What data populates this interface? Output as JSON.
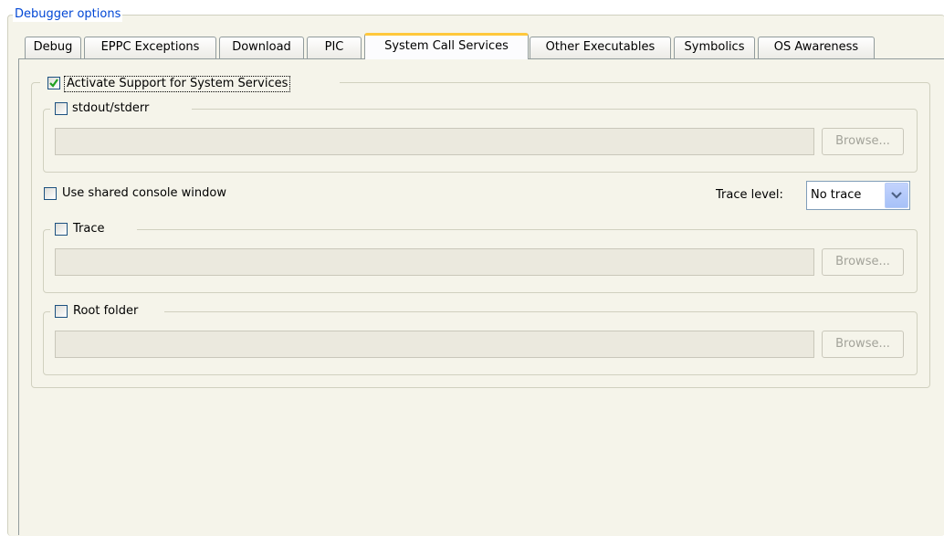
{
  "group_title": "Debugger options",
  "tabs": [
    {
      "label": "Debug"
    },
    {
      "label": "EPPC Exceptions"
    },
    {
      "label": "Download"
    },
    {
      "label": "PIC"
    },
    {
      "label": "System Call Services",
      "active": true
    },
    {
      "label": "Other Executables"
    },
    {
      "label": "Symbolics"
    },
    {
      "label": "OS Awareness"
    }
  ],
  "activate_support": {
    "label": "Activate Support for System Services",
    "checked": true
  },
  "stdout": {
    "label": "stdout/stderr",
    "checked": false,
    "path": "",
    "browse": "Browse..."
  },
  "shared_console": {
    "label": "Use shared console window",
    "checked": false
  },
  "trace_level": {
    "label": "Trace level:",
    "value": "No trace"
  },
  "trace": {
    "label": "Trace",
    "checked": false,
    "path": "",
    "browse": "Browse..."
  },
  "root_folder": {
    "label": "Root folder",
    "checked": false,
    "path": "",
    "browse": "Browse..."
  },
  "colors": {
    "legend": "#0046d5",
    "tab_active_accent": "#ffc83c",
    "checkmark": "#21a121",
    "panel": "#f5f4ea"
  }
}
